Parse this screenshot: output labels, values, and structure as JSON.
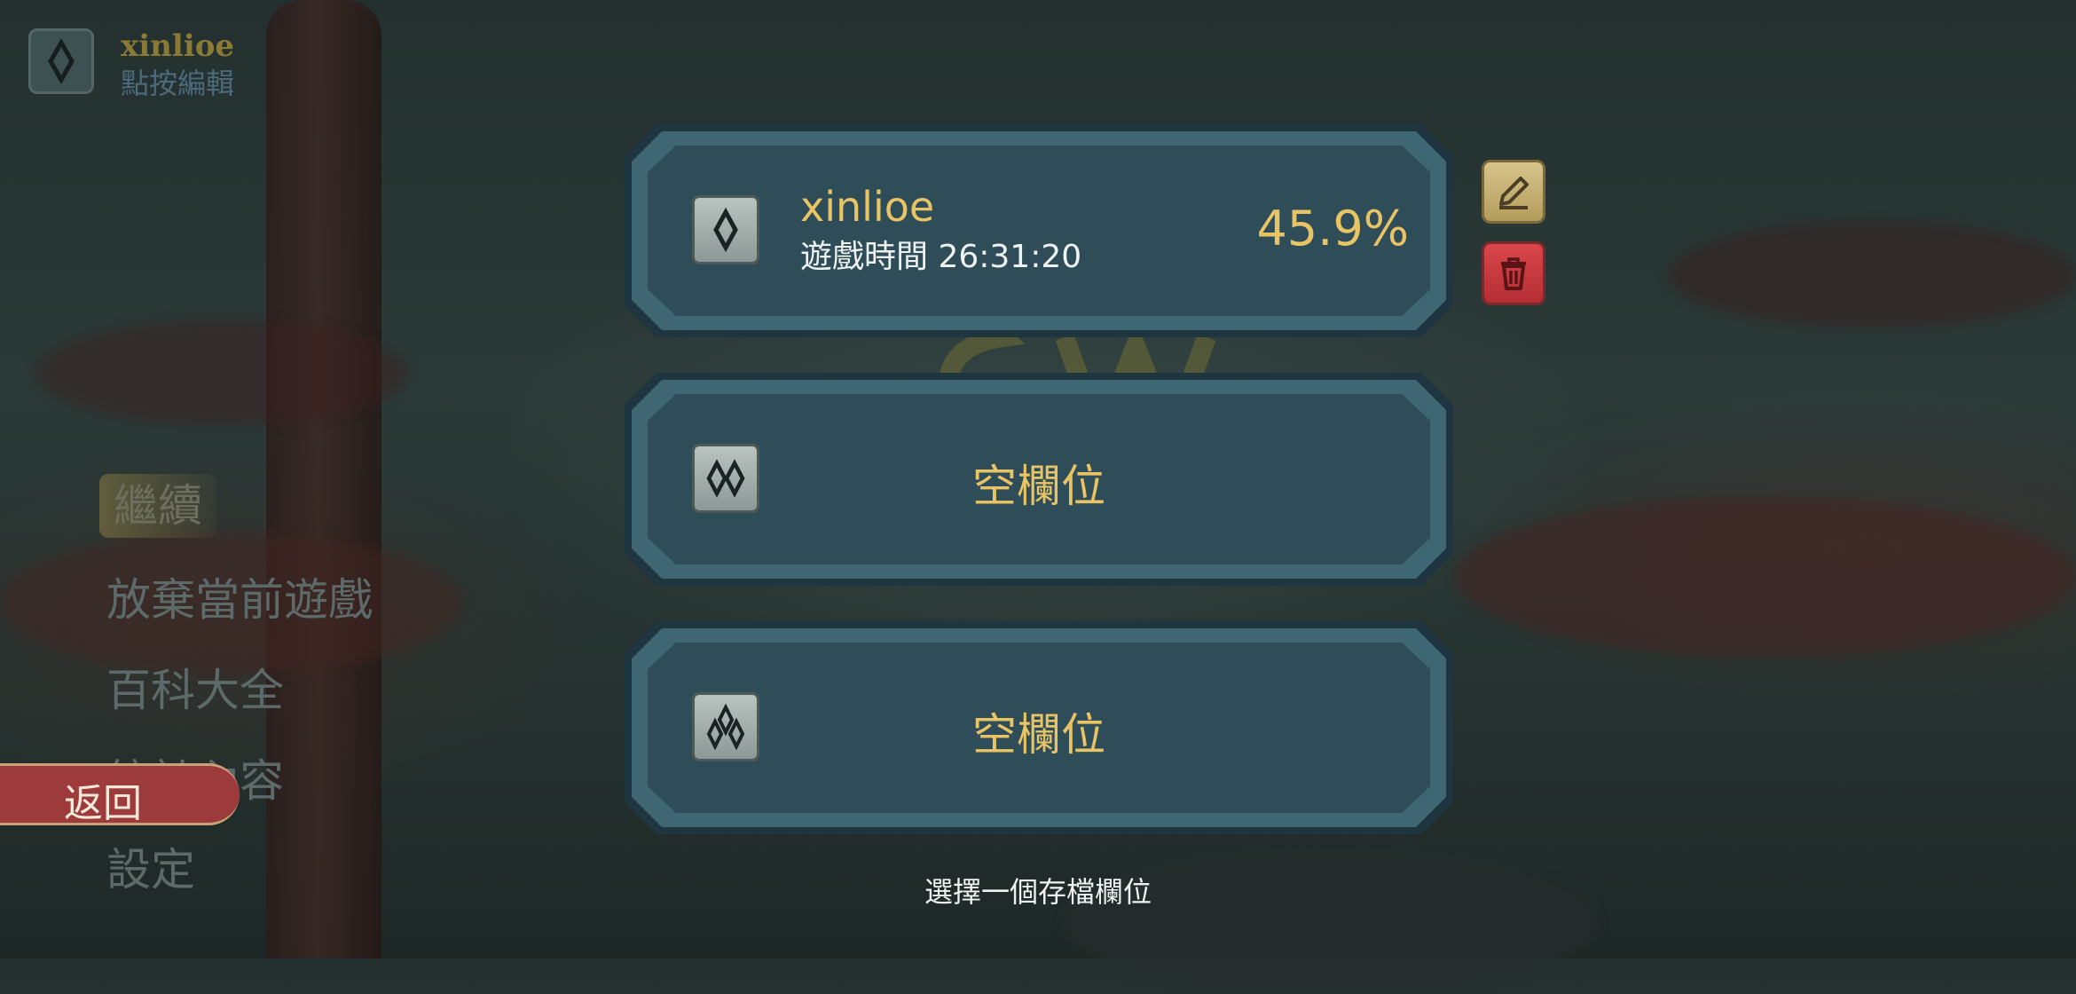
{
  "profile": {
    "name": "xinlioe",
    "hint": "點按編輯"
  },
  "menu": {
    "items": [
      "繼續",
      "放棄當前遊戲",
      "百科大全",
      "統計內容",
      "設定"
    ],
    "back_label": "返回"
  },
  "slots": [
    {
      "name": "xinlioe",
      "playtime": "遊戲時間 26:31:20",
      "completion": "45.9%",
      "icon": "one-diamond-rune-icon"
    },
    {
      "label": "空欄位",
      "icon": "two-diamond-rune-icon"
    },
    {
      "label": "空欄位",
      "icon": "three-diamond-rune-icon"
    }
  ],
  "prompt": "選擇一個存檔欄位",
  "colors": {
    "gold": "#e8c464",
    "panel": "#2f4b55",
    "delete": "#c23a3e",
    "edit": "#c9b574"
  }
}
